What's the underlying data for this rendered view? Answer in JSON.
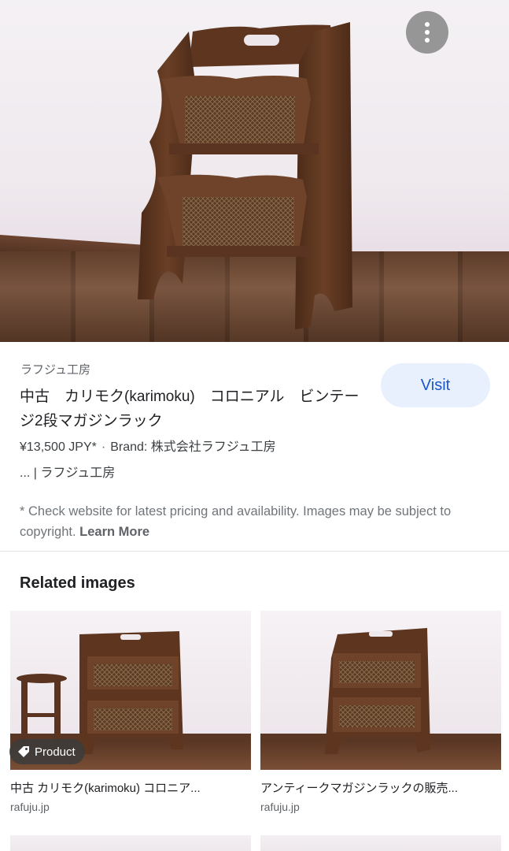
{
  "hero": {
    "alt": "karimoku vintage 2-tier magazine rack",
    "menu_icon": "more-vertical-icon"
  },
  "result": {
    "source_name": "ラフジュ工房",
    "title": "中古　カリモク(karimoku)　コロニアル　ビンテージ2段マガジンラック",
    "price": "¥13,500 JPY*",
    "separator": "·",
    "brand": "Brand: 株式会社ラフジュ工房",
    "source_suffix": "... | ラフジュ工房",
    "visit_label": "Visit",
    "disclaimer": "* Check website for latest pricing and availability. Images may be subject to copyright.",
    "learn_more": "Learn More"
  },
  "related": {
    "title": "Related images",
    "items": [
      {
        "title": "中古 カリモク(karimoku) コロニア...",
        "source": "rafuju.jp",
        "badge": "Product",
        "badge_icon": "tag-icon"
      },
      {
        "title": "アンティークマガジンラックの販売...",
        "source": "rafuju.jp"
      }
    ]
  },
  "colors": {
    "visit_bg": "#e8f0fe",
    "visit_text": "#1a56c7",
    "wood": "#5a3420"
  }
}
